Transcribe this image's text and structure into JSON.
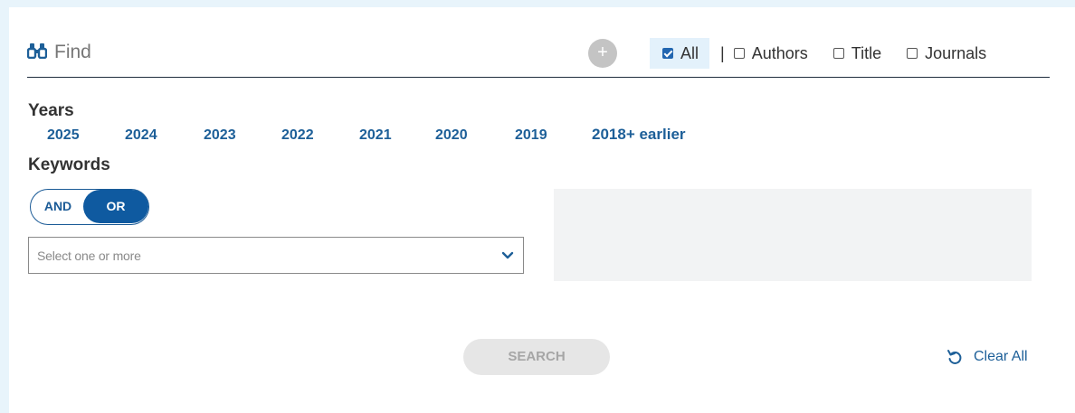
{
  "find": {
    "placeholder": "Find",
    "icon": "binoculars-icon",
    "add_icon": "plus-icon"
  },
  "filters": [
    {
      "label": "All",
      "checked": true
    },
    {
      "label": "Authors",
      "checked": false
    },
    {
      "label": "Title",
      "checked": false
    },
    {
      "label": "Journals",
      "checked": false
    }
  ],
  "filter_separator": "|",
  "years": {
    "label": "Years",
    "items": [
      "2025",
      "2024",
      "2023",
      "2022",
      "2021",
      "2020",
      "2019",
      "2018+ earlier"
    ]
  },
  "keywords": {
    "label": "Keywords",
    "toggle": {
      "and": "AND",
      "or": "OR",
      "selected": "OR"
    },
    "select_placeholder": "Select one or more"
  },
  "actions": {
    "search": "SEARCH",
    "clear_all": "Clear All"
  },
  "colors": {
    "accent": "#1d5f98",
    "toggle_active": "#0f5aa0",
    "page_bg": "#e8f4fb",
    "disabled": "#e6e6e6"
  }
}
